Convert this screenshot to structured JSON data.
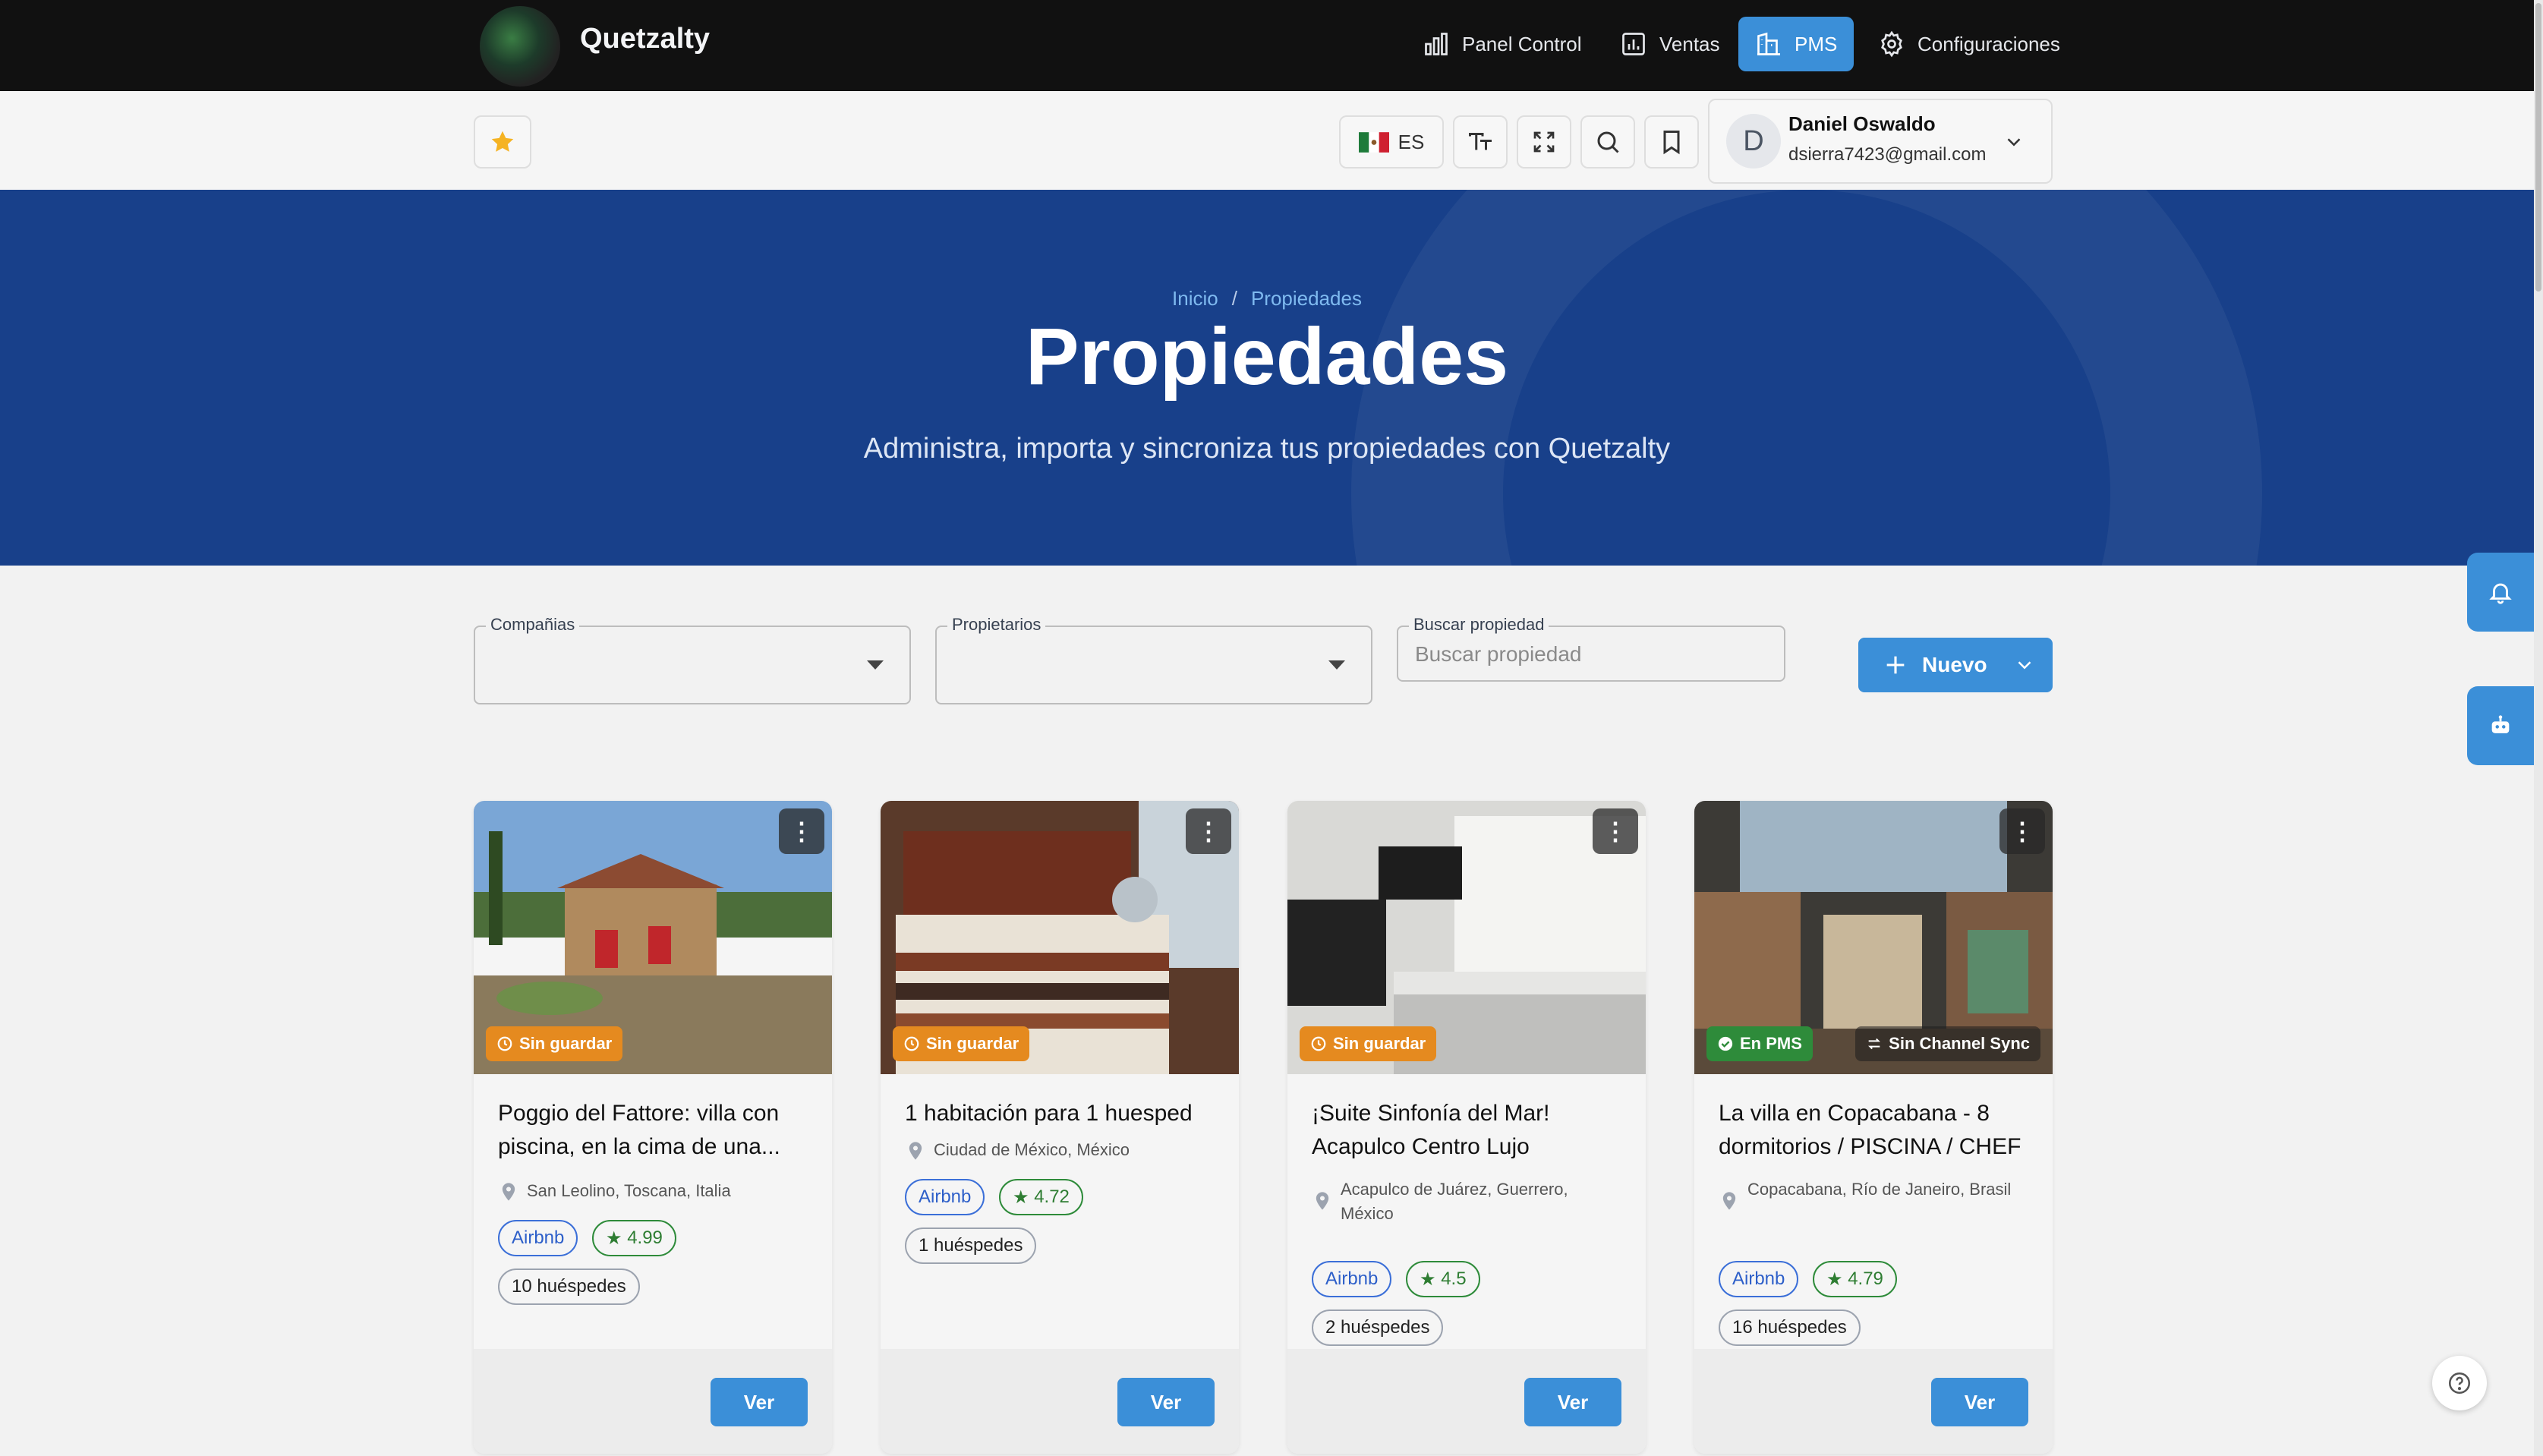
{
  "brand": {
    "name": "Quetzalty"
  },
  "nav": [
    {
      "label": "Panel Control",
      "icon": "bar-chart-icon"
    },
    {
      "label": "Ventas",
      "icon": "sales-chart-icon"
    },
    {
      "label": "PMS",
      "icon": "building-icon",
      "active": true
    },
    {
      "label": "Configuraciones",
      "icon": "gear-icon"
    }
  ],
  "toolbar": {
    "language": "ES"
  },
  "user": {
    "initial": "D",
    "name": "Daniel Oswaldo",
    "email": "dsierra7423@gmail.com"
  },
  "hero": {
    "breadcrumb": [
      "Inicio",
      "Propiedades"
    ],
    "title": "Propiedades",
    "subtitle": "Administra, importa y sincroniza tus propiedades con Quetzalty"
  },
  "filters": {
    "companies_label": "Compañias",
    "owners_label": "Propietarios",
    "search_label": "Buscar propiedad",
    "search_placeholder": "Buscar propiedad",
    "new_button": "Nuevo"
  },
  "cards": [
    {
      "title": "Poggio del Fattore: villa con piscina, en la cima de una...",
      "location": "San Leolino, Toscana, Italia",
      "platform": "Airbnb",
      "rating": "4.99",
      "guests": "10 huéspedes",
      "badge": "Sin guardar",
      "action": "Ver"
    },
    {
      "title": "1 habitación para 1 huesped",
      "location": "Ciudad de México, México",
      "platform": "Airbnb",
      "rating": "4.72",
      "guests": "1 huéspedes",
      "badge": "Sin guardar",
      "action": "Ver"
    },
    {
      "title": "¡Suite Sinfonía del Mar! Acapulco Centro Lujo",
      "location": "Acapulco de Juárez, Guerrero, México",
      "platform": "Airbnb",
      "rating": "4.5",
      "guests": "2 huéspedes",
      "badge": "Sin guardar",
      "action": "Ver"
    },
    {
      "title": "La villa en Copacabana - 8 dormitorios / PISCINA / CHEF",
      "location": "Copacabana, Río de Janeiro, Brasil",
      "platform": "Airbnb",
      "rating": "4.79",
      "guests": "16 huéspedes",
      "badge": "En PMS",
      "badge2": "Sin Channel Sync",
      "action": "Ver"
    }
  ],
  "colors": {
    "primary": "#3b8fd8",
    "hero": "#18408a",
    "topbar": "#111111",
    "warning": "#e58a1f",
    "success": "#2e8b3a"
  }
}
